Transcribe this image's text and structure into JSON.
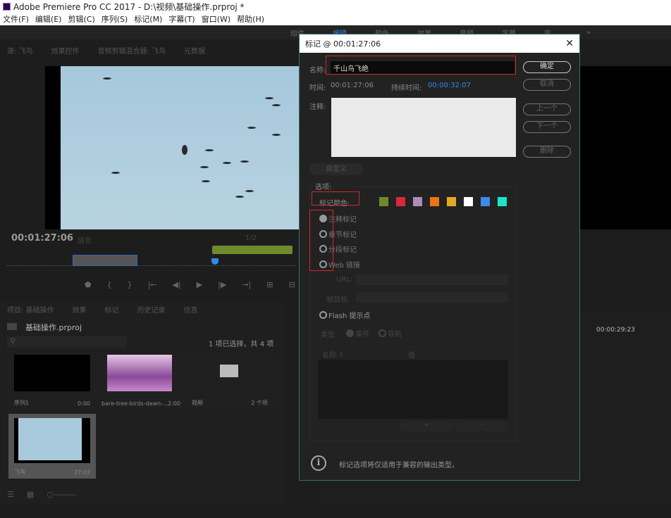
{
  "app": {
    "title": "Adobe Premiere Pro CC 2017 - D:\\视频\\基础操作.prproj *"
  },
  "menu": [
    "文件(F)",
    "编辑(E)",
    "剪辑(C)",
    "序列(S)",
    "标记(M)",
    "字幕(T)",
    "窗口(W)",
    "帮助(H)"
  ],
  "workspace": {
    "tabs": [
      "组件",
      "编辑",
      "颜色",
      "效果",
      "音频",
      "字幕",
      "库"
    ],
    "more": "»",
    "active": "编辑"
  },
  "source": {
    "tabs": [
      "源: 飞鸟",
      "效果控件",
      "音频剪辑混合器: 飞鸟",
      "元数据"
    ],
    "timecode": "00:01:27:06",
    "fit": "适合",
    "resolution": "1/2"
  },
  "project": {
    "tabs": [
      "项目: 基础操作",
      "效果",
      "标记",
      "历史记录",
      "信息"
    ],
    "file": "基础操作.prproj",
    "count": "1 项已选择，共 4 项",
    "items": [
      {
        "name": "序列1",
        "dur": "0:00"
      },
      {
        "name": "bare-tree-birds-dawn-...",
        "dur": "2:00"
      },
      {
        "name": "视频",
        "dur": "2 个项"
      },
      {
        "name": "飞鸟",
        "dur": "27:07"
      }
    ]
  },
  "timeline": {
    "timecode": "00:00:29:23"
  },
  "dialog": {
    "title": "标记 @ 00:01:27:06",
    "name_label": "名称:",
    "name_value": "千山鸟飞绝",
    "time_label": "时间:",
    "time_value": "00:01:27:06",
    "duration_label": "持续时间:",
    "duration_value": "00:00:32:07",
    "comment_label": "注释:",
    "custom_button": "自定义",
    "buttons": {
      "ok": "确定",
      "cancel": "取消",
      "prev": "上一个",
      "next": "下一个",
      "delete": "删除"
    },
    "options_label": "选项:",
    "color_label": "标记颜色:",
    "colors": [
      "#6f8a2c",
      "#d9283a",
      "#b08ab8",
      "#ee7413",
      "#e0a928",
      "#ffffff",
      "#3a8bea",
      "#19e6c8"
    ],
    "marker_types": [
      {
        "label": "注释标记",
        "checked": true
      },
      {
        "label": "章节标记",
        "checked": false
      },
      {
        "label": "分段标记",
        "checked": false
      },
      {
        "label": "Web 链接",
        "checked": false
      }
    ],
    "url_label": "URL:",
    "frame_target_label": "帧目标:",
    "flash_label": "Flash 提示点",
    "type_label": "类型:",
    "type_event": "事件",
    "type_nav": "导航",
    "col_name": "名称 ↑",
    "col_value": "值",
    "add": "+",
    "remove": "-",
    "info_text": "标记选项将仅适用于兼容的输出类型。"
  }
}
